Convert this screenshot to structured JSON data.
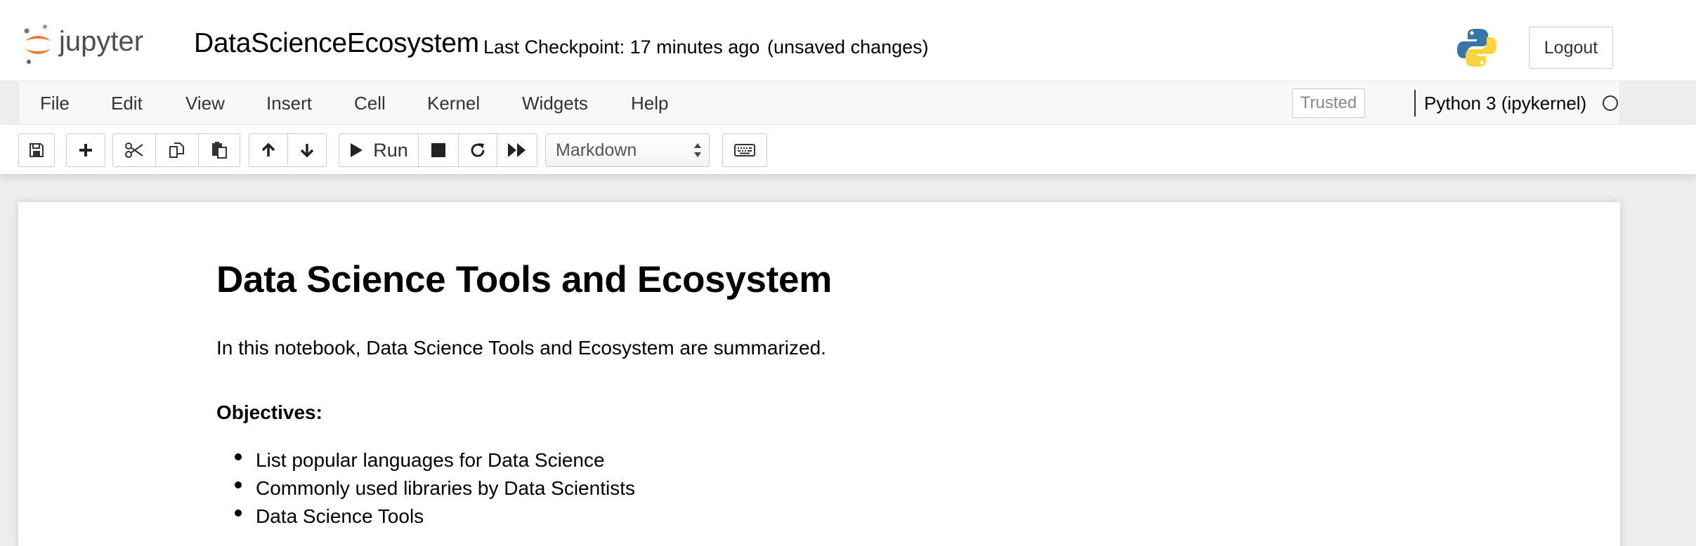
{
  "header": {
    "logo_text": "jupyter",
    "notebook_name": "DataScienceEcosystem",
    "checkpoint": "Last Checkpoint: 17 minutes ago",
    "unsaved": "(unsaved changes)",
    "logout_label": "Logout"
  },
  "menu": {
    "items": [
      "File",
      "Edit",
      "View",
      "Insert",
      "Cell",
      "Kernel",
      "Widgets",
      "Help"
    ],
    "trusted_label": "Trusted",
    "kernel_name": "Python 3 (ipykernel)"
  },
  "toolbar": {
    "run_label": "Run",
    "cell_type": "Markdown",
    "icons": [
      "save-icon",
      "plus-icon",
      "cut-icon",
      "copy-icon",
      "paste-icon",
      "arrow-up-icon",
      "arrow-down-icon",
      "play-icon",
      "stop-icon",
      "restart-icon",
      "fast-forward-icon",
      "keyboard-icon"
    ]
  },
  "cell": {
    "title": "Data Science Tools and Ecosystem",
    "intro": "In this notebook, Data Science Tools and Ecosystem are summarized.",
    "objectives_heading": "Objectives:",
    "objectives": [
      "List popular languages for Data Science",
      "Commonly used libraries by Data Scientists",
      "Data Science Tools"
    ]
  },
  "colors": {
    "jupyter_orange": "#f37726",
    "python_blue": "#3776ab",
    "python_yellow": "#ffd43b"
  }
}
